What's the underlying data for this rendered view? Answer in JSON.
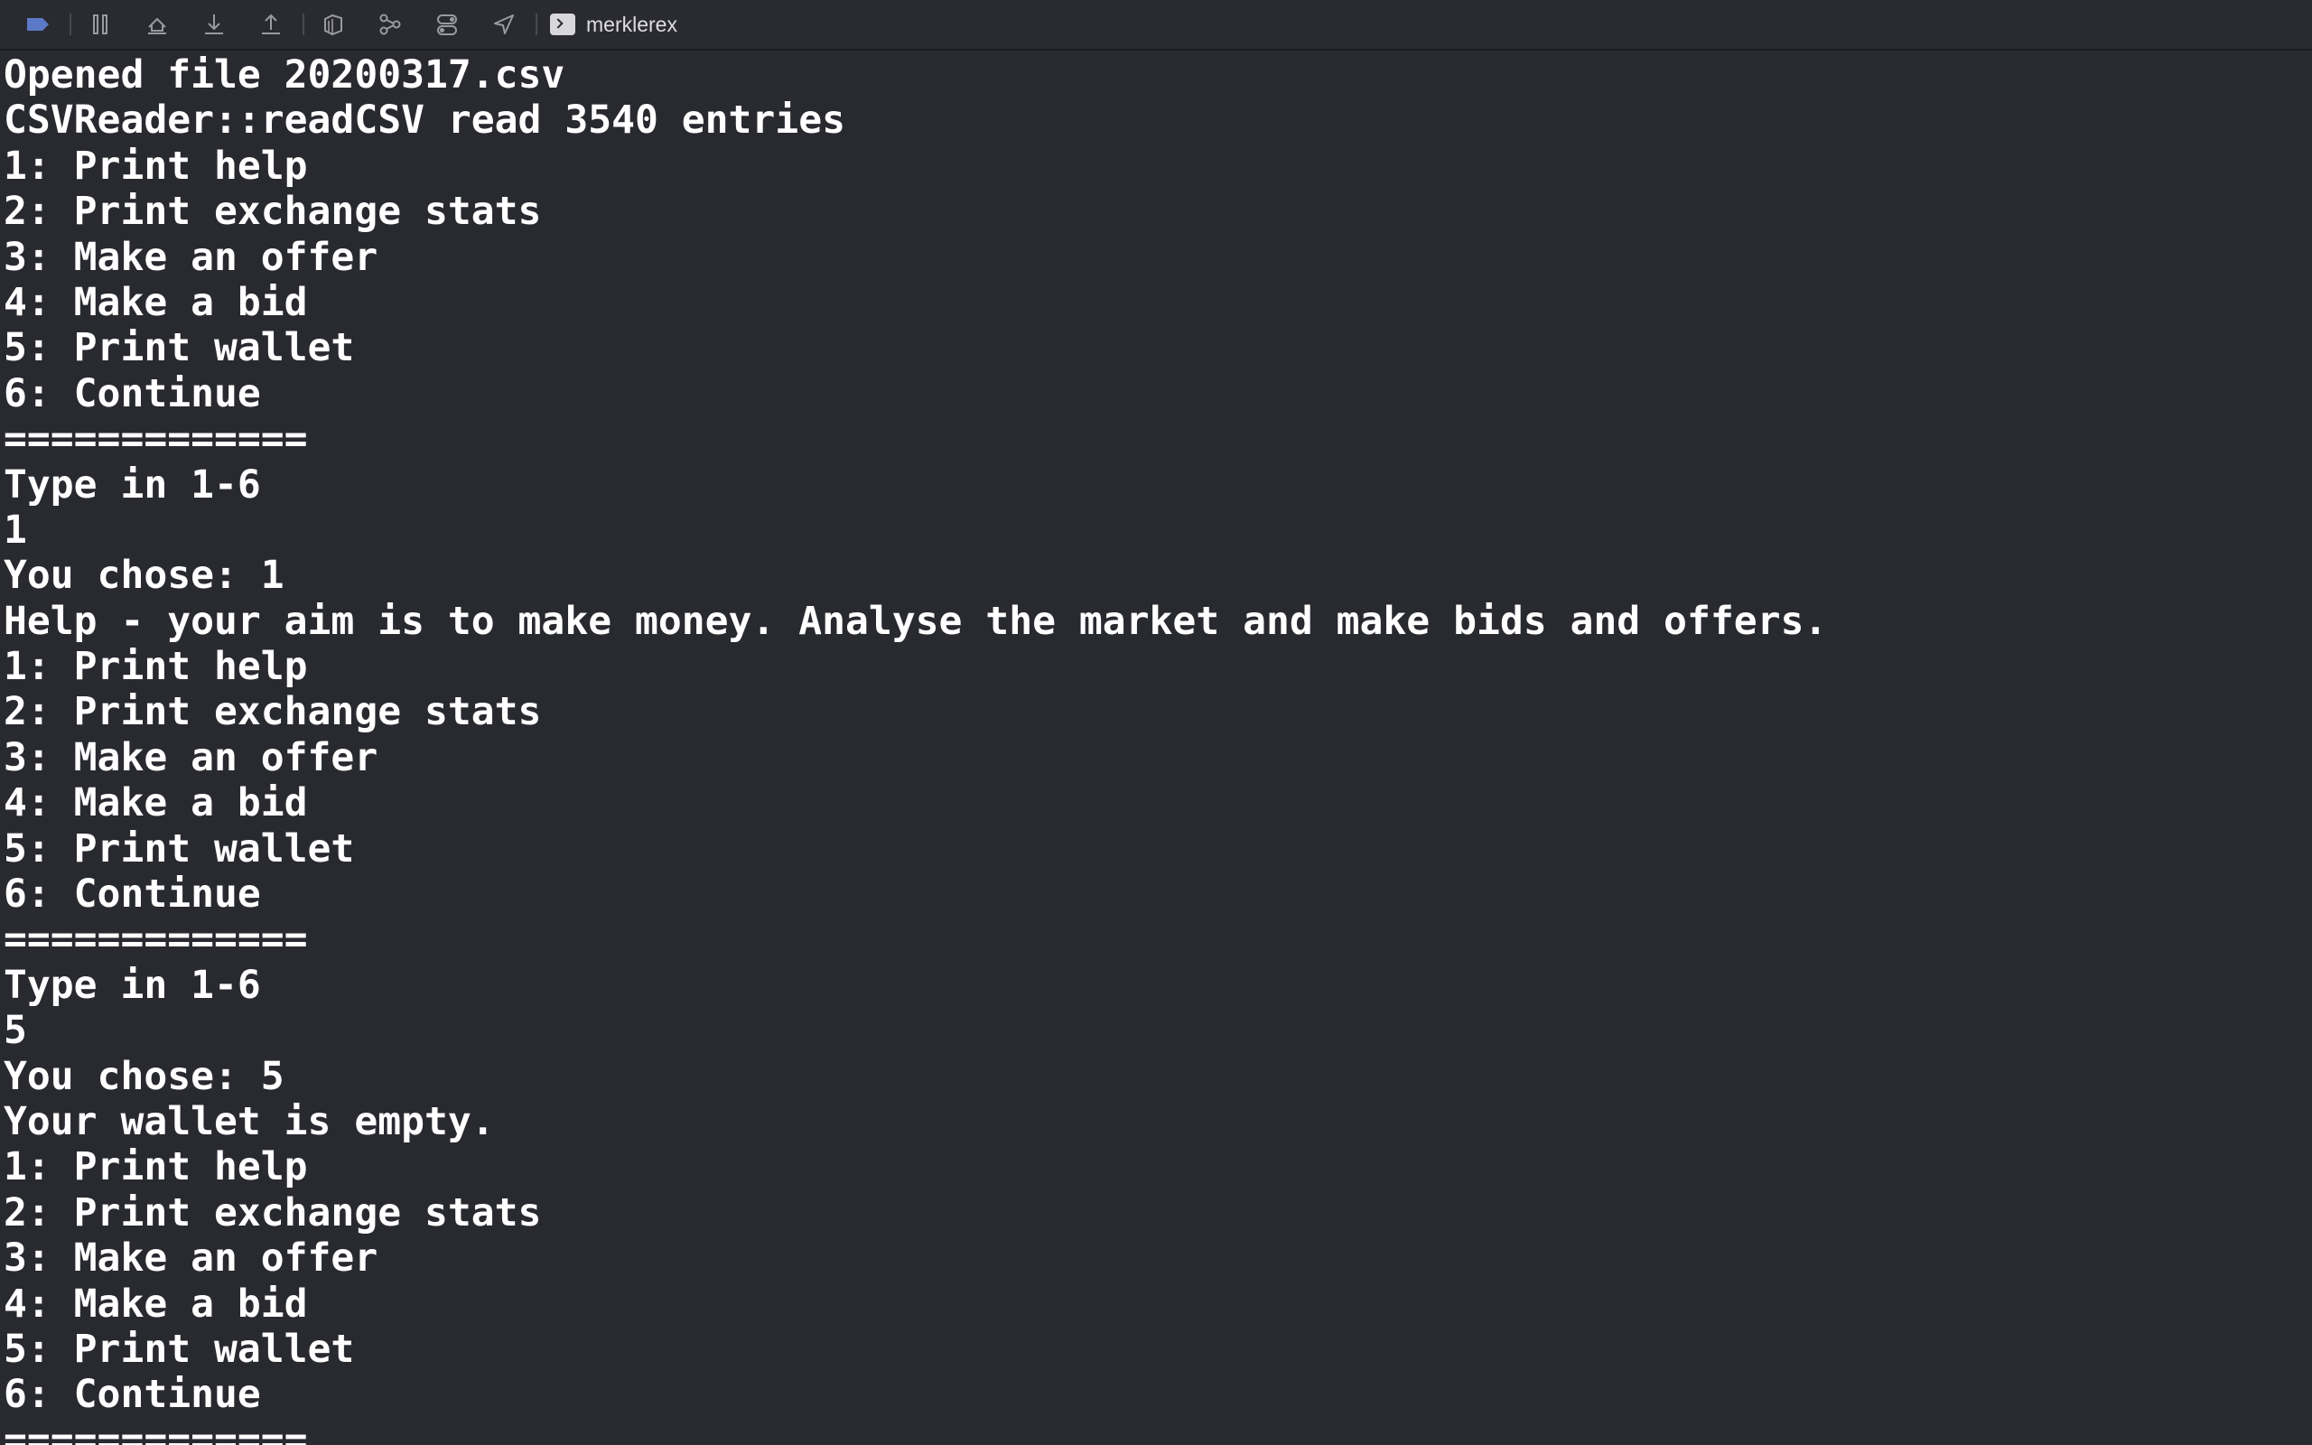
{
  "toolbar": {
    "buttons": [
      {
        "name": "breakpoints-toggle",
        "icon": "breakpoint-icon"
      },
      {
        "name": "pause-button",
        "icon": "pause-icon"
      },
      {
        "name": "step-over-button",
        "icon": "step-over-icon"
      },
      {
        "name": "step-into-button",
        "icon": "step-into-icon"
      },
      {
        "name": "step-out-button",
        "icon": "step-out-icon"
      },
      {
        "name": "debug-view-hierarchy-button",
        "icon": "view-hierarchy-icon"
      },
      {
        "name": "memory-graph-button",
        "icon": "memory-graph-icon"
      },
      {
        "name": "environment-overrides-button",
        "icon": "environment-overrides-icon"
      },
      {
        "name": "simulate-location-button",
        "icon": "location-arrow-icon"
      }
    ],
    "target_name": "merklerex"
  },
  "console": {
    "lines": [
      "Opened file 20200317.csv",
      "CSVReader::readCSV read 3540 entries",
      "1: Print help",
      "2: Print exchange stats",
      "3: Make an offer",
      "4: Make a bid",
      "5: Print wallet",
      "6: Continue",
      "=============",
      "Type in 1-6",
      "1",
      "You chose: 1",
      "Help - your aim is to make money. Analyse the market and make bids and offers.",
      "1: Print help",
      "2: Print exchange stats",
      "3: Make an offer",
      "4: Make a bid",
      "5: Print wallet",
      "6: Continue",
      "=============",
      "Type in 1-6",
      "5",
      "You chose: 5",
      "Your wallet is empty.",
      "1: Print help",
      "2: Print exchange stats",
      "3: Make an offer",
      "4: Make a bid",
      "5: Print wallet",
      "6: Continue",
      "============="
    ]
  }
}
